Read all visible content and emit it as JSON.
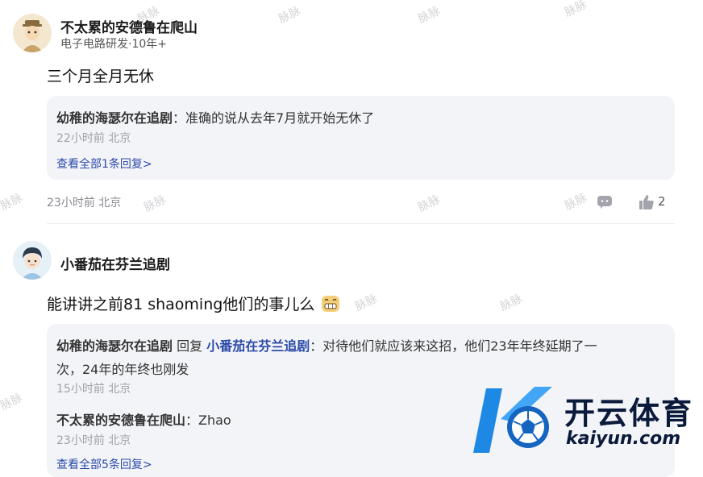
{
  "comments": [
    {
      "name": "不太累的安德鲁在爬山",
      "subtitle": "电子电路研发·10年+",
      "body": "三个月全月无休",
      "replies": [
        {
          "author": "幼稚的海瑟尔在追剧",
          "text": "：准确的说从去年7月就开始无休了",
          "meta": "22小时前 北京"
        }
      ],
      "view_all": "查看全部1条回复>",
      "meta": "23小时前 北京",
      "likes": "2"
    },
    {
      "name": "小番茄在芬兰追剧",
      "body": "能讲讲之前81 shaoming他们的事儿么",
      "replies": [
        {
          "author": "幼稚的海瑟尔在追剧",
          "reply_word": " 回复 ",
          "target": "小番茄在芬兰追剧",
          "text_line1": "：对待他们就应该来这招，他们23年年终延期了一",
          "text_line2": "次，24年的年终也刚发",
          "meta": "15小时前 北京"
        },
        {
          "author": "不太累的安德鲁在爬山",
          "text": "：Zhao",
          "meta": "23小时前 北京"
        }
      ],
      "view_all": "查看全部5条回复>"
    }
  ],
  "watermark": "脉脉",
  "overlay_logo": {
    "brand": "开云体育",
    "url": "kaiyun.com",
    "colors": {
      "primary": "#1e88e5",
      "dark": "#0a1a3a"
    }
  },
  "icons": {
    "comment": "comment-icon",
    "like": "thumbs-up-icon",
    "emoji": "grinning-emoji-icon"
  }
}
